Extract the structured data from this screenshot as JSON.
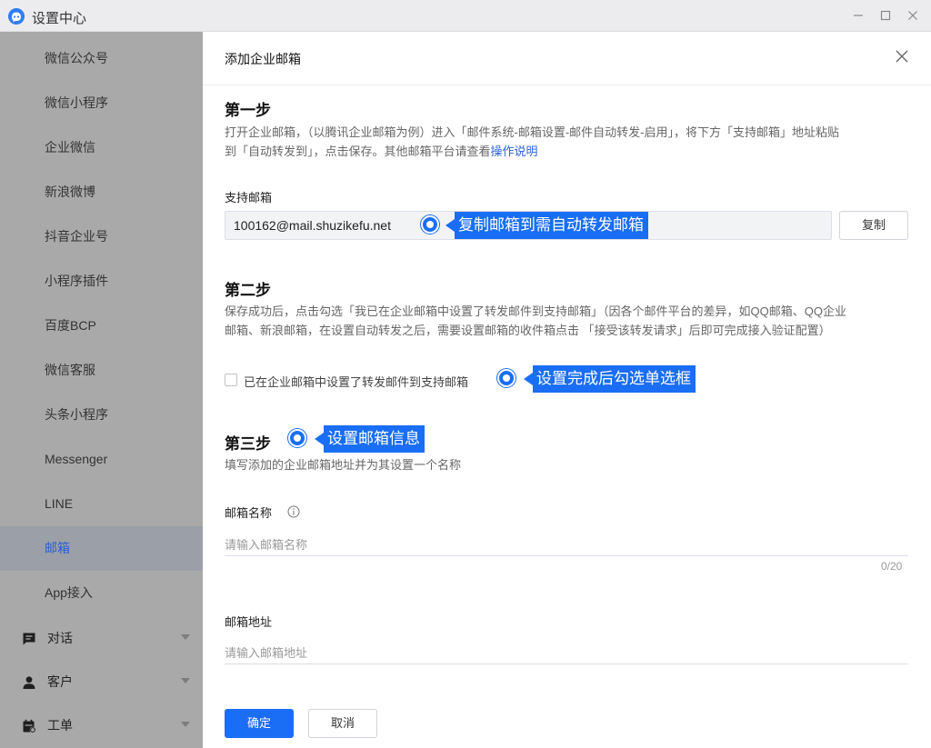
{
  "window": {
    "title": "设置中心"
  },
  "sidebar": {
    "items": [
      {
        "label": "微信公众号"
      },
      {
        "label": "微信小程序"
      },
      {
        "label": "企业微信"
      },
      {
        "label": "新浪微博"
      },
      {
        "label": "抖音企业号"
      },
      {
        "label": "小程序插件"
      },
      {
        "label": "百度BCP"
      },
      {
        "label": "微信客服"
      },
      {
        "label": "头条小程序"
      },
      {
        "label": "Messenger"
      },
      {
        "label": "LINE"
      },
      {
        "label": "邮箱",
        "active": true
      },
      {
        "label": "App接入"
      }
    ],
    "groups": [
      {
        "label": "对话",
        "icon": "chat-icon"
      },
      {
        "label": "客户",
        "icon": "user-icon"
      },
      {
        "label": "工单",
        "icon": "ticket-icon"
      }
    ],
    "active_color": "#2a5fd0"
  },
  "dialog": {
    "title": "添加企业邮箱",
    "step1": {
      "title": "第一步",
      "desc_line1": "打开企业邮箱，（以腾讯企业邮箱为例）进入「邮件系统-邮箱设置-邮件自动转发-启用」，将下方「支持邮箱」地址粘贴",
      "desc_line2": "到「自动转发到」，点击保存。其他邮箱平台请查看",
      "desc_link": "操作说明",
      "support_label": "支持邮箱",
      "support_email": "100162@mail.shuzikefu.net",
      "copy_button": "复制"
    },
    "step2": {
      "title": "第二步",
      "desc_line1": "保存成功后，点击勾选「我已在企业邮箱中设置了转发邮件到支持邮箱」（因各个邮件平台的差异，如QQ邮箱、QQ企业",
      "desc_line2": "邮箱、新浪邮箱，在设置自动转发之后，需要设置邮箱的收件箱点击 「接受该转发请求」后即可完成接入验证配置）",
      "checkbox_label": "已在企业邮箱中设置了转发邮件到支持邮箱",
      "checked": false
    },
    "step3": {
      "title": "第三步",
      "desc": "填写添加的企业邮箱地址并为其设置一个名称",
      "name_label": "邮箱名称",
      "name_placeholder": "请输入邮箱名称",
      "name_counter": "0/20",
      "address_label": "邮箱地址",
      "address_placeholder": "请输入邮箱地址"
    },
    "ok_button": "确定",
    "cancel_button": "取消"
  },
  "annotations": {
    "copy_email": "复制邮箱到需自动转发邮箱",
    "check_box": "设置完成后勾选单选框",
    "mail_info": "设置邮箱信息",
    "color": "#1a6ef5"
  }
}
